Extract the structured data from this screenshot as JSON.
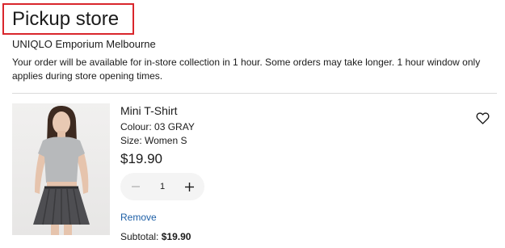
{
  "section": {
    "title": "Pickup store",
    "store_name": "UNIQLO Emporium Melbourne",
    "note": "Your order will be available for in-store collection in 1 hour. Some orders may take longer. 1 hour window only applies during store opening times."
  },
  "item": {
    "name": "Mini T-Shirt",
    "colour": "Colour: 03 GRAY",
    "size": "Size: Women S",
    "price": "$19.90",
    "quantity": "1",
    "remove_label": "Remove",
    "subtotal_label": "Subtotal:",
    "subtotal_value": "$19.90",
    "wishlist_icon": "heart-outline-icon",
    "minus_icon": "minus-icon",
    "plus_icon": "plus-icon"
  },
  "colors": {
    "highlight_border": "#d9262c",
    "link": "#1d5fa6",
    "stepper_bg": "#f4f4f4",
    "divider": "#dadada"
  }
}
